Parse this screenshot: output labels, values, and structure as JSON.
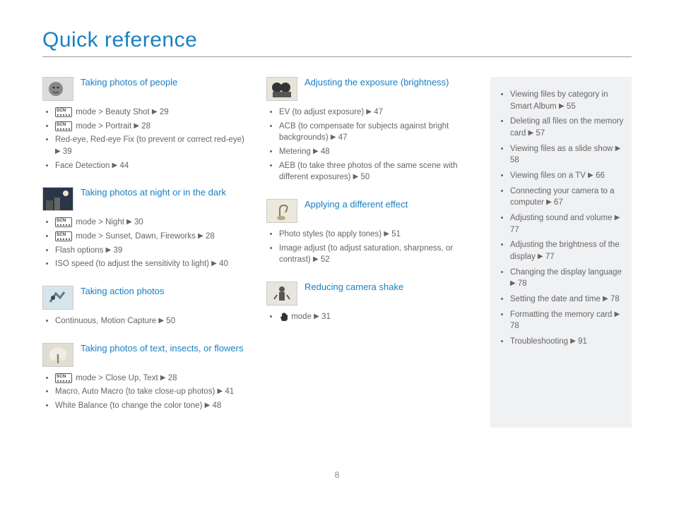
{
  "title": "Quick reference",
  "page_number": "8",
  "col1": [
    {
      "title": "Taking photos of people",
      "thumb": "face",
      "items": [
        {
          "icon": "scn",
          "text": " mode > Beauty Shot ",
          "page": "29"
        },
        {
          "icon": "scn",
          "text": " mode > Portrait ",
          "page": "28"
        },
        {
          "text": "Red-eye, Red-eye Fix (to prevent or correct red-eye) ",
          "page": "39"
        },
        {
          "text": "Face Detection ",
          "page": "44"
        }
      ]
    },
    {
      "title": "Taking photos at night or in the dark",
      "thumb": "night",
      "items": [
        {
          "icon": "scn",
          "text": " mode > Night ",
          "page": "30"
        },
        {
          "icon": "scn",
          "text": " mode > Sunset, Dawn, Fireworks ",
          "page": "28"
        },
        {
          "text": "Flash options ",
          "page": "39"
        },
        {
          "text": "ISO speed (to adjust the sensitivity to light) ",
          "page": "40"
        }
      ]
    },
    {
      "title": "Taking action photos",
      "thumb": "action",
      "items": [
        {
          "text": "Continuous, Motion Capture ",
          "page": "50"
        }
      ]
    },
    {
      "title": "Taking photos of text, insects, or flowers",
      "thumb": "macro",
      "items": [
        {
          "icon": "scn",
          "text": " mode > Close Up, Text ",
          "page": "28"
        },
        {
          "text": "Macro, Auto Macro (to take close-up photos) ",
          "page": "41"
        },
        {
          "text": "White Balance (to change the color tone) ",
          "page": "48"
        }
      ]
    }
  ],
  "col2": [
    {
      "title": "Adjusting the exposure (brightness)",
      "thumb": "expo",
      "items": [
        {
          "text": "EV (to adjust exposure) ",
          "page": "47"
        },
        {
          "text": "ACB (to compensate for subjects against bright backgrounds) ",
          "page": "47"
        },
        {
          "text": "Metering ",
          "page": "48"
        },
        {
          "text": "AEB (to take three photos of the same scene with different exposures) ",
          "page": "50"
        }
      ]
    },
    {
      "title": "Applying a different effect",
      "thumb": "effect",
      "items": [
        {
          "text": "Photo styles (to apply tones) ",
          "page": "51"
        },
        {
          "text": "Image adjust (to adjust saturation, sharpness, or contrast) ",
          "page": "52"
        }
      ]
    },
    {
      "title": "Reducing camera shake",
      "thumb": "shake",
      "items": [
        {
          "icon": "hand",
          "text": " mode ",
          "page": "31"
        }
      ]
    }
  ],
  "sidebar": [
    {
      "text": "Viewing files by category in Smart Album ",
      "page": "55"
    },
    {
      "text": "Deleting all files on the memory card ",
      "page": "57"
    },
    {
      "text": "Viewing files as a slide show ",
      "page": "58"
    },
    {
      "text": "Viewing files on a TV ",
      "page": "66"
    },
    {
      "text": "Connecting your camera to a computer ",
      "page": "67"
    },
    {
      "text": "Adjusting sound and volume ",
      "page": "77"
    },
    {
      "text": "Adjusting the brightness of the display ",
      "page": "77"
    },
    {
      "text": "Changing the display language ",
      "page": "78"
    },
    {
      "text": "Setting the date and time ",
      "page": "78"
    },
    {
      "text": "Formatting the memory card ",
      "page": "78"
    },
    {
      "text": "Troubleshooting ",
      "page": "91"
    }
  ]
}
